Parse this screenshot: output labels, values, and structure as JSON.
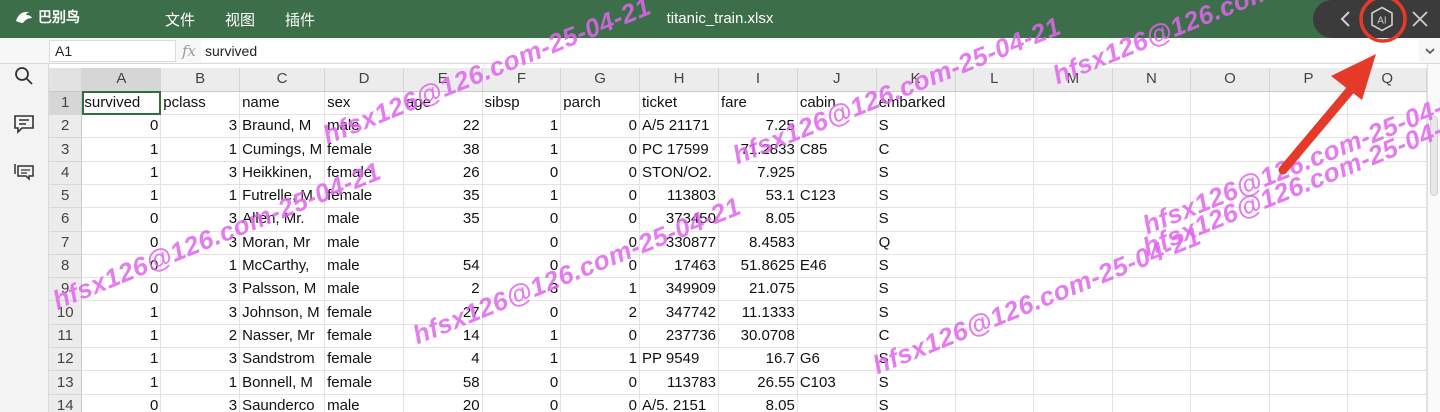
{
  "app": {
    "name": "巴别鸟",
    "title": "titanic_train.xlsx"
  },
  "menu": [
    {
      "label": "文件"
    },
    {
      "label": "视图"
    },
    {
      "label": "插件"
    }
  ],
  "window_controls": {
    "back_icon": "chevron-left-icon",
    "ai_label": "AI",
    "close_icon": "close-icon"
  },
  "formula_bar": {
    "cell_ref": "A1",
    "fx": "fx",
    "value": "survived"
  },
  "sidebar": {
    "icons": [
      "search-icon",
      "comment-icon",
      "chat-list-icon"
    ]
  },
  "columns": [
    "A",
    "B",
    "C",
    "D",
    "E",
    "F",
    "G",
    "H",
    "I",
    "J",
    "K",
    "L",
    "M",
    "N",
    "O",
    "P",
    "Q"
  ],
  "rows": [
    {
      "n": "1",
      "cells": [
        "survived",
        "pclass",
        "name",
        "sex",
        "age",
        "sibsp",
        "parch",
        "ticket",
        "fare",
        "cabin",
        "embarked",
        "",
        "",
        "",
        "",
        "",
        ""
      ]
    },
    {
      "n": "2",
      "cells": [
        "0",
        "3",
        "Braund, M",
        "male",
        "22",
        "1",
        "0",
        "A/5 21171",
        "7.25",
        "",
        "S",
        "",
        "",
        "",
        "",
        "",
        ""
      ]
    },
    {
      "n": "3",
      "cells": [
        "1",
        "1",
        "Cumings, M",
        "female",
        "38",
        "1",
        "0",
        "PC 17599",
        "71.2833",
        "C85",
        "C",
        "",
        "",
        "",
        "",
        "",
        ""
      ]
    },
    {
      "n": "4",
      "cells": [
        "1",
        "3",
        "Heikkinen,",
        "female",
        "26",
        "0",
        "0",
        "STON/O2.",
        "7.925",
        "",
        "S",
        "",
        "",
        "",
        "",
        "",
        ""
      ]
    },
    {
      "n": "5",
      "cells": [
        "1",
        "1",
        "Futrelle, M",
        "female",
        "35",
        "1",
        "0",
        "113803",
        "53.1",
        "C123",
        "S",
        "",
        "",
        "",
        "",
        "",
        ""
      ]
    },
    {
      "n": "6",
      "cells": [
        "0",
        "3",
        "Allen, Mr.",
        "male",
        "35",
        "0",
        "0",
        "373450",
        "8.05",
        "",
        "S",
        "",
        "",
        "",
        "",
        "",
        ""
      ]
    },
    {
      "n": "7",
      "cells": [
        "0",
        "3",
        "Moran, Mr",
        "male",
        "",
        "0",
        "0",
        "330877",
        "8.4583",
        "",
        "Q",
        "",
        "",
        "",
        "",
        "",
        ""
      ]
    },
    {
      "n": "8",
      "cells": [
        "0",
        "1",
        "McCarthy,",
        "male",
        "54",
        "0",
        "0",
        "17463",
        "51.8625",
        "E46",
        "S",
        "",
        "",
        "",
        "",
        "",
        ""
      ]
    },
    {
      "n": "9",
      "cells": [
        "0",
        "3",
        "Palsson, M",
        "male",
        "2",
        "3",
        "1",
        "349909",
        "21.075",
        "",
        "S",
        "",
        "",
        "",
        "",
        "",
        ""
      ]
    },
    {
      "n": "10",
      "cells": [
        "1",
        "3",
        "Johnson, M",
        "female",
        "27",
        "0",
        "2",
        "347742",
        "11.1333",
        "",
        "S",
        "",
        "",
        "",
        "",
        "",
        ""
      ]
    },
    {
      "n": "11",
      "cells": [
        "1",
        "2",
        "Nasser, Mr",
        "female",
        "14",
        "1",
        "0",
        "237736",
        "30.0708",
        "",
        "C",
        "",
        "",
        "",
        "",
        "",
        ""
      ]
    },
    {
      "n": "12",
      "cells": [
        "1",
        "3",
        "Sandstrom",
        "female",
        "4",
        "1",
        "1",
        "PP 9549",
        "16.7",
        "G6",
        "S",
        "",
        "",
        "",
        "",
        "",
        ""
      ]
    },
    {
      "n": "13",
      "cells": [
        "1",
        "1",
        "Bonnell, M",
        "female",
        "58",
        "0",
        "0",
        "113783",
        "26.55",
        "C103",
        "S",
        "",
        "",
        "",
        "",
        "",
        ""
      ]
    },
    {
      "n": "14",
      "cells": [
        "0",
        "3",
        "Saunderco",
        "male",
        "20",
        "0",
        "0",
        "A/5. 2151",
        "8.05",
        "",
        "S",
        "",
        "",
        "",
        "",
        "",
        ""
      ]
    }
  ],
  "watermark": {
    "text": "hfsx126@126.com-25-04-21",
    "color": "#e066ee"
  },
  "annotation": {
    "color": "#e53a2a"
  }
}
